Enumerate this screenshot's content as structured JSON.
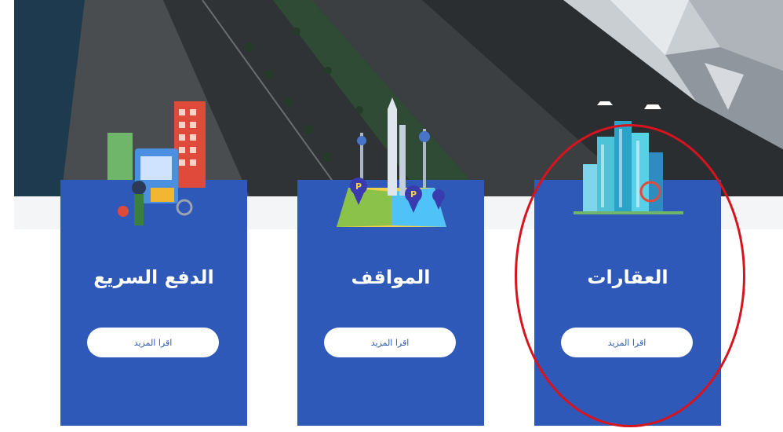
{
  "cards": [
    {
      "title": "الدفع السريع",
      "button_label": "اقرا المزيد",
      "icon": "quick-pay-illustration"
    },
    {
      "title": "المواقف",
      "button_label": "اقرا المزيد",
      "icon": "parking-map-illustration"
    },
    {
      "title": "العقارات",
      "button_label": "اقرا المزيد",
      "icon": "real-estate-illustration"
    }
  ],
  "colors": {
    "card_blue": "#2e59b8",
    "highlight_red": "#d7141d",
    "band_gray": "#f4f5f7"
  }
}
